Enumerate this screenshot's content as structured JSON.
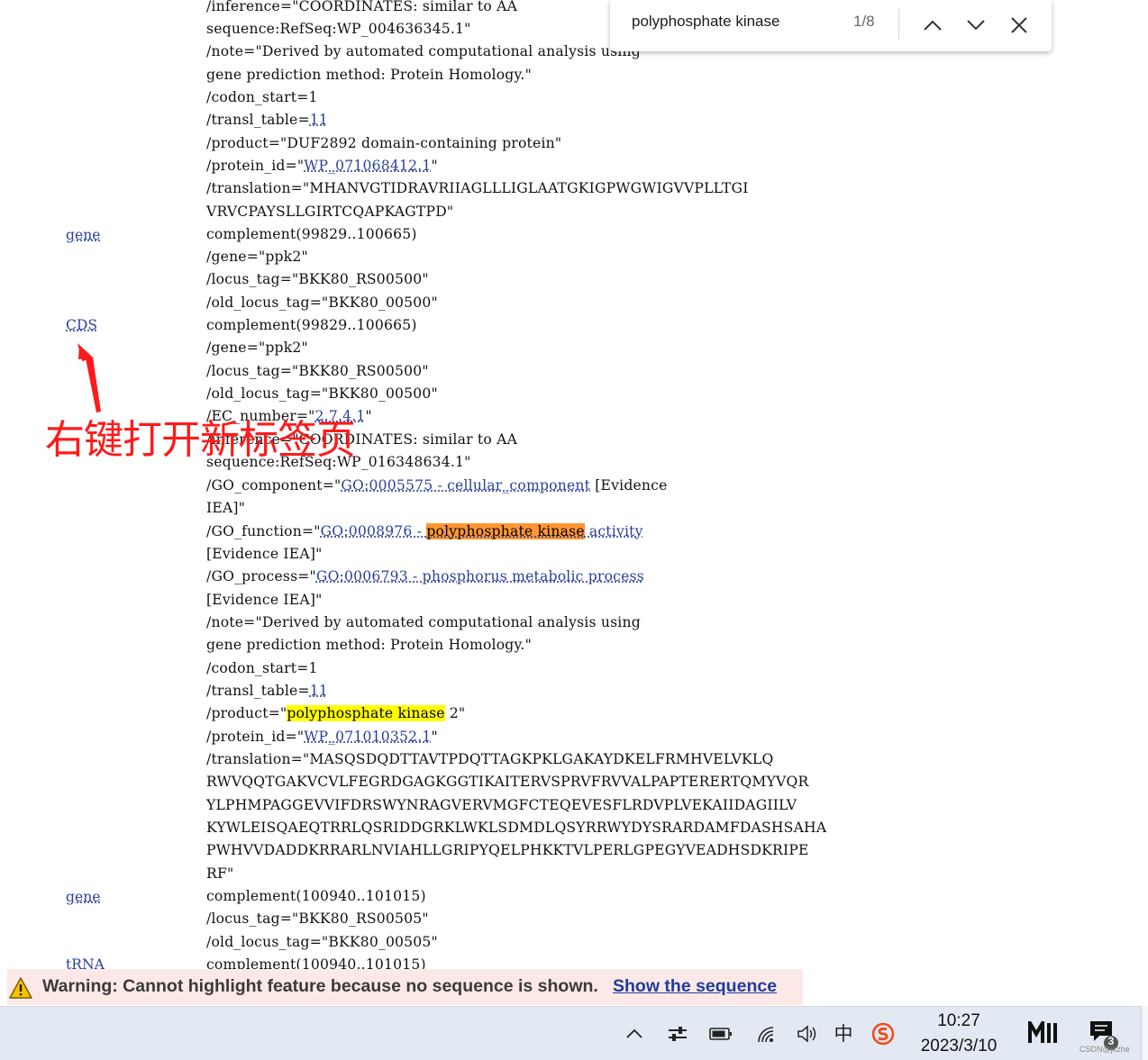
{
  "find_bar": {
    "query": "polyphosphate kinase",
    "match_count": "1/8",
    "prev_icon": "chevron-up-icon",
    "next_icon": "chevron-down-icon",
    "close_icon": "close-icon"
  },
  "features": [
    {
      "name": "gene"
    },
    {
      "name": "CDS"
    },
    {
      "name": "gene"
    },
    {
      "name": "tRNA"
    }
  ],
  "record": {
    "l1": "/inference=\"COORDINATES: similar to AA",
    "l2": "sequence:RefSeq:WP_004636345.1\"",
    "l3": "/note=\"Derived by automated computational analysis using",
    "l4": "gene prediction method: Protein Homology.\"",
    "l5": "/codon_start=1",
    "l6_pre": "/transl_table=",
    "l6_link": "11",
    "l7": "/product=\"DUF2892 domain-containing protein\"",
    "l8_pre": "/protein_id=\"",
    "l8_link": "WP_071068412.1",
    "l8_post": "\"",
    "l9": "/translation=\"MHANVGTIDRAVRIIAGLLLIGLAATGKIGPWGWIGVVPLLTGI",
    "l10": "VRVCPAYSLLGIRTCQAPKAGTPD\"",
    "g1": "complement(99829..100665)",
    "g2": "/gene=\"ppk2\"",
    "g3": "/locus_tag=\"BKK80_RS00500\"",
    "g4": "/old_locus_tag=\"BKK80_00500\"",
    "c1": "complement(99829..100665)",
    "c2": "/gene=\"ppk2\"",
    "c3": "/locus_tag=\"BKK80_RS00500\"",
    "c4": "/old_locus_tag=\"BKK80_00500\"",
    "c5_pre": "/EC_number=\"",
    "c5_link": "2.7.4.1",
    "c5_post": "\"",
    "c6": "/inference=\"COORDINATES: similar to AA",
    "c7": "sequence:RefSeq:WP_016348634.1\"",
    "c8_pre": "/GO_component=\"",
    "c8_link": "GO:0005575 - cellular_component",
    "c8_post": " [Evidence",
    "c9": "IEA]\"",
    "c10_pre": "/GO_function=\"",
    "c10_link_a": "GO:0008976 - ",
    "c10_hl": "polyphosphate kinase",
    "c10_link_b": " activity",
    "c11": "[Evidence IEA]\"",
    "c12_pre": "/GO_process=\"",
    "c12_link": "GO:0006793 - phosphorus metabolic process",
    "c13": "[Evidence IEA]\"",
    "c14": "/note=\"Derived by automated computational analysis using",
    "c15": "gene prediction method: Protein Homology.\"",
    "c16": "/codon_start=1",
    "c17_pre": "/transl_table=",
    "c17_link": "11",
    "c18_pre": "/product=\"",
    "c18_hl": "polyphosphate kinase",
    "c18_post": " 2\"",
    "c19_pre": "/protein_id=\"",
    "c19_link": "WP_071010352.1",
    "c19_post": "\"",
    "c20": "/translation=\"MASQSDQDTTAVTPDQTTAGKPKLGAKAYDKELFRMHVELVKLQ",
    "c21": "RWVQQTGAKVCVLFEGRDGAGKGGTIKAITERVSPRVFRVVALPAPTERERTQMYVQR",
    "c22": "YLPHMPAGGEVVIFDRSWYNRAGVERVMGFCTEQEVESFLRDVPLVEKAIIDAGIILV",
    "c23": "KYWLEISQAEQTRRLQSRIDDGRKLWKLSDMDLQSYRRWYDYSRARDAMFDASHSAHA",
    "c24": "PWHVVDADDKRRARLNVIAHLLGRIPYQELPHKKTVLPERLGPEGYVEADHSDKRIPE",
    "c25": "RF\"",
    "h1": "complement(100940..101015)",
    "h2": "/locus_tag=\"BKK80_RS00505\"",
    "h3": "/old_locus_tag=\"BKK80_00505\"",
    "t1": "complement(100940..101015)"
  },
  "annotation": {
    "text": "右键打开新标签页",
    "color": "#ff1a1a"
  },
  "warning": {
    "icon": "warning-triangle-icon",
    "text": "Warning: Cannot highlight feature because no sequence is shown.",
    "link": "Show the sequence"
  },
  "taskbar": {
    "tray_icons": [
      "chevron-up-icon",
      "pen-settings-icon",
      "battery-icon",
      "wifi-icon",
      "speaker-icon",
      "ime-icon",
      "sogou-icon"
    ],
    "ime_label": "中",
    "time": "10:27",
    "date": "2023/3/10",
    "notification_count": "3",
    "watermark": "CSDN@jkzhe"
  },
  "colors": {
    "link": "#2a3f9a",
    "highlight_current": "#ff9632",
    "highlight_other": "#ffff00",
    "warning_bg": "#fde8e8"
  }
}
